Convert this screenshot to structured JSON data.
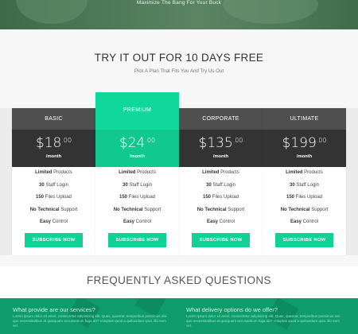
{
  "hero": {
    "tagline": "Maximize The Bang For Your Buck"
  },
  "pricing": {
    "title": "TRY IT OUT FOR 10 DAYS FREE",
    "subtitle": "Pick A Plan That Fits You And Try Us Out"
  },
  "plans": [
    {
      "name": "BASIC",
      "currency": "$",
      "dollars": "18",
      "cents": ".00",
      "period": "/month",
      "features": [
        {
          "bold": "Limited",
          "rest": " Products"
        },
        {
          "bold": "30",
          "rest": " Staff Login"
        },
        {
          "bold": "150",
          "rest": " Files Upload"
        },
        {
          "bold": "No Technical",
          "rest": " Support"
        },
        {
          "bold": "Easy",
          "rest": " Control"
        }
      ],
      "button": "SUBSCRIBE NOW"
    },
    {
      "name": "PREMIUM",
      "currency": "$",
      "dollars": "24",
      "cents": ".00",
      "period": "/month",
      "features": [
        {
          "bold": "Limited",
          "rest": " Products"
        },
        {
          "bold": "30",
          "rest": " Staff Login"
        },
        {
          "bold": "150",
          "rest": " Files Upload"
        },
        {
          "bold": "No Technical",
          "rest": " Support"
        },
        {
          "bold": "Easy",
          "rest": " Control"
        }
      ],
      "button": "SUBSCRIBE NOW"
    },
    {
      "name": "CORPORATE",
      "currency": "$",
      "dollars": "135",
      "cents": ".00",
      "period": "/month",
      "features": [
        {
          "bold": "Limited",
          "rest": " Products"
        },
        {
          "bold": "30",
          "rest": " Staff Login"
        },
        {
          "bold": "150",
          "rest": " Files Upload"
        },
        {
          "bold": "No Technical",
          "rest": " Support"
        },
        {
          "bold": "Easy",
          "rest": " Control"
        }
      ],
      "button": "SUBSCRIBE NOW"
    },
    {
      "name": "ULTIMATE",
      "currency": "$",
      "dollars": "199",
      "cents": ".00",
      "period": "/month",
      "features": [
        {
          "bold": "Limited",
          "rest": " Products"
        },
        {
          "bold": "30",
          "rest": " Staff Login"
        },
        {
          "bold": "150",
          "rest": " Files Upload"
        },
        {
          "bold": "No Technical",
          "rest": " Support"
        },
        {
          "bold": "Easy",
          "rest": " Control"
        }
      ],
      "button": "SUBSCRIBE NOW"
    }
  ],
  "faq": {
    "title": "FREQUENTLY ASKED QUESTIONS",
    "questions": [
      {
        "q": "What provide are our services?",
        "a": "Lorem ipsum dolor sit amet, consectetur adipisicing elit. Quas, quaerat, temporibus possimus nisi quo necessitatibus at quisquam accusantium fuga ab? Voluptas quod a quibusdam quia, illo eum vel."
      },
      {
        "q": "What delivery options do we offer?",
        "a": "Lorem ipsum dolor sit amet, consectetur adipisicing elit. Quas, quaerat, temporibus possimus nisi quo necessitatibus at quisquam accusantium fuga ab? Voluptas quod a quibusdam quia, illo eum vel."
      }
    ]
  },
  "colors": {
    "accent": "#12d195",
    "featured_head": "#10d89a",
    "dark_head": "#4f4f4f",
    "dark_price": "#333333",
    "faq_band": "#0f9c6c"
  }
}
